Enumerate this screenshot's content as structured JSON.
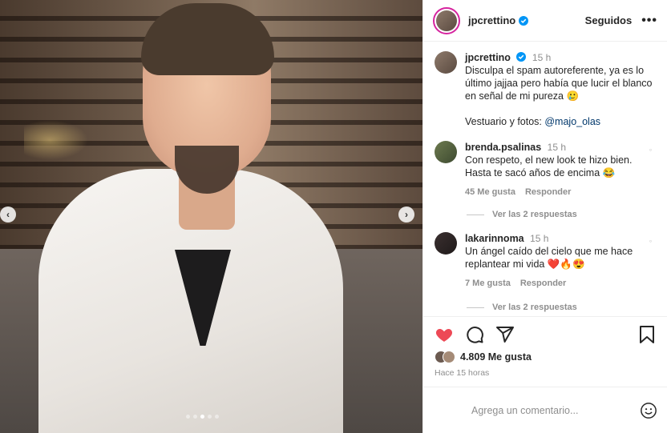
{
  "post": {
    "author": "jpcrettino",
    "following_label": "Seguidos",
    "more_label": "•••",
    "caption": {
      "username": "jpcrettino",
      "time": "15 h",
      "text": "Disculpa el spam autoreferente, ya es lo último jajjaa pero había que lucir el blanco en señal de mi pureza 🥲",
      "credits_prefix": "Vestuario y fotos: ",
      "credits_mention": "@majo_olas"
    },
    "comments": [
      {
        "username": "brenda.psalinas",
        "time": "15 h",
        "text": "Con respeto, el new look te hizo bien. Hasta te sacó años de encima 😂",
        "likes": "45 Me gusta",
        "reply": "Responder",
        "view_replies": "Ver las 2 respuestas"
      },
      {
        "username": "lakarinnoma",
        "time": "15 h",
        "text": "Un ángel caído del cielo que me hace replantear mi vida ❤️🔥😍",
        "likes": "7 Me gusta",
        "reply": "Responder",
        "view_replies": "Ver las 2 respuestas"
      }
    ],
    "likes_count": "4.809 Me gusta",
    "posted_ago": "Hace 15 horas",
    "comment_placeholder": "Agrega un comentario...",
    "carousel": {
      "current_slide": 3,
      "total_slides": 5
    }
  },
  "colors": {
    "like_red": "#ed4956",
    "verified_blue": "#0095f6",
    "mention": "#00376b"
  },
  "icons": [
    "verified-icon",
    "more-icon",
    "heart-icon",
    "comment-icon",
    "share-icon",
    "save-icon",
    "emoji-icon",
    "smile-icon",
    "chevron-left-icon",
    "chevron-right-icon"
  ]
}
